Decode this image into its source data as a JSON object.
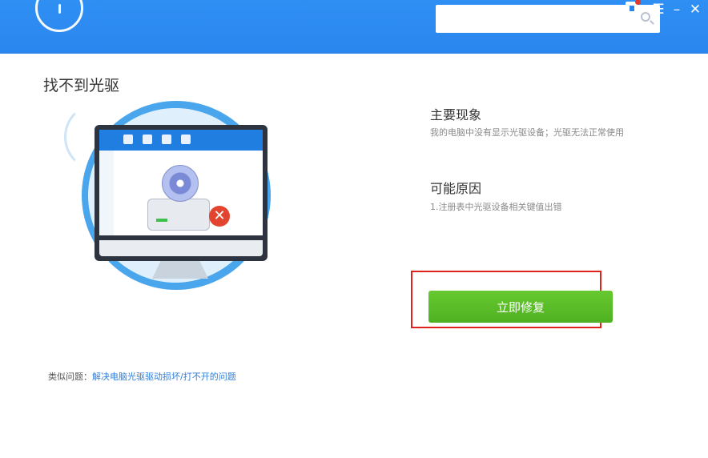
{
  "page": {
    "title": "找不到光驱"
  },
  "symptom": {
    "heading": "主要现象",
    "text": "我的电脑中没有显示光驱设备；光驱无法正常使用"
  },
  "cause": {
    "heading": "可能原因",
    "text": "1.注册表中光驱设备相关键值出错"
  },
  "actions": {
    "repair_label": "立即修复"
  },
  "similar": {
    "label": "类似问题：",
    "link": "解决电脑光驱驱动损坏/打不开的问题"
  },
  "titlebar": {
    "menu_glyph": "☰",
    "minimize_glyph": "–",
    "close_glyph": "✕"
  },
  "icons": {
    "error": "✕"
  },
  "colors": {
    "header_blue": "#2a86ee",
    "repair_green": "#52b526",
    "highlight_red": "#e0221e",
    "link_blue": "#2f7ed8"
  }
}
